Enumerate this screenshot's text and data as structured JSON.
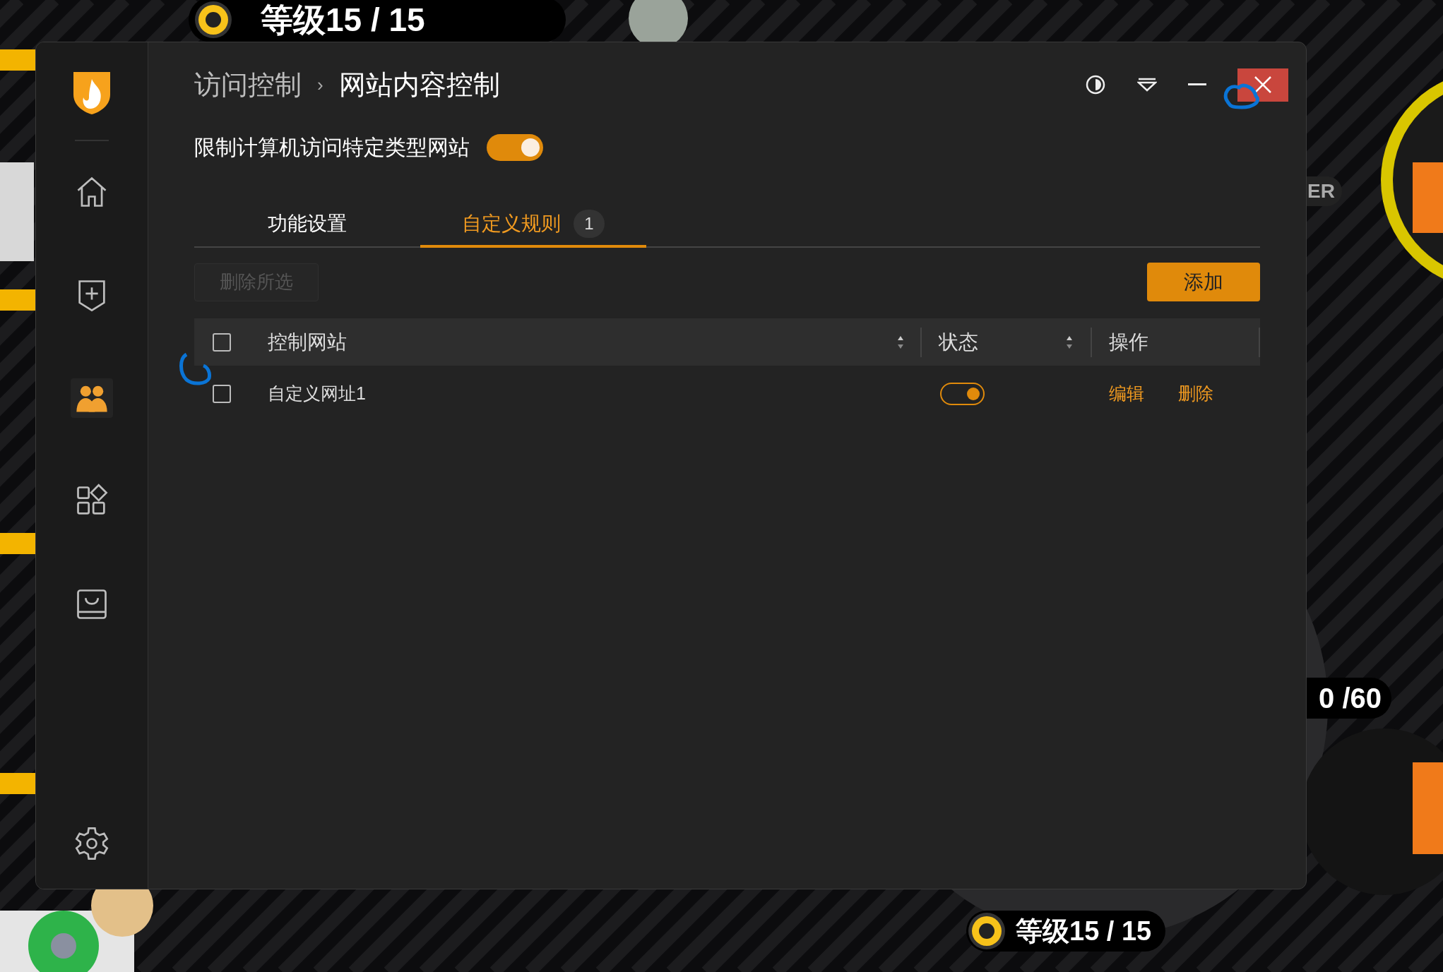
{
  "game_hud": {
    "top_level": "等级15 / 15",
    "bottom_level": "等级15 / 15",
    "counter": "0 /60",
    "tag": "ER"
  },
  "sidebar": {
    "items": [
      {
        "selected": false
      },
      {
        "selected": false
      },
      {
        "selected": true
      },
      {
        "selected": false
      },
      {
        "selected": false
      }
    ]
  },
  "breadcrumb": {
    "parent": "访问控制",
    "separator": "›",
    "current": "网站内容控制"
  },
  "restrict": {
    "label": "限制计算机访问特定类型网站",
    "on": true
  },
  "tabs": [
    {
      "label": "功能设置",
      "selected": false
    },
    {
      "label": "自定义规则",
      "selected": true,
      "count": "1"
    }
  ],
  "toolbar": {
    "delete_selected": {
      "label": "删除所选",
      "disabled": true
    },
    "add": {
      "label": "添加"
    }
  },
  "table": {
    "select_all_checked": false,
    "columns": [
      "控制网站",
      "状态",
      "操作"
    ],
    "rows": [
      {
        "site": "自定义网址1",
        "checked": false,
        "enabled": true,
        "actions": [
          "编辑",
          "删除"
        ]
      }
    ]
  }
}
